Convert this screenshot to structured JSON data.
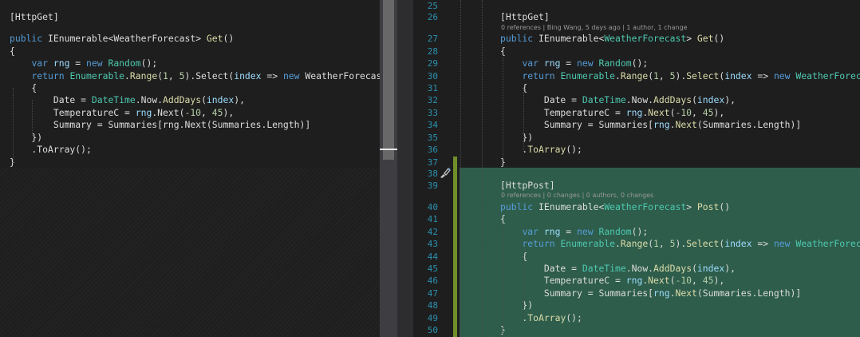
{
  "left": {
    "lines": [
      [
        {
          "t": "[HttpGet]",
          "c": "pl"
        }
      ],
      [],
      [
        {
          "t": "public ",
          "c": "kw"
        },
        {
          "t": "IEnumerable",
          "c": "pl"
        },
        {
          "t": "<",
          "c": "pl"
        },
        {
          "t": "WeatherForecast",
          "c": "pl"
        },
        {
          "t": "> ",
          "c": "pl"
        },
        {
          "t": "Get",
          "c": "fn"
        },
        {
          "t": "()",
          "c": "pl"
        }
      ],
      [
        {
          "t": "{",
          "c": "pl"
        }
      ],
      [
        {
          "t": "    ",
          "c": "pl"
        },
        {
          "t": "var ",
          "c": "kw"
        },
        {
          "t": "rng",
          "c": "va"
        },
        {
          "t": " = ",
          "c": "pl"
        },
        {
          "t": "new ",
          "c": "kw"
        },
        {
          "t": "Random",
          "c": "ty"
        },
        {
          "t": "();",
          "c": "pl"
        }
      ],
      [
        {
          "t": "    ",
          "c": "pl"
        },
        {
          "t": "return ",
          "c": "kw"
        },
        {
          "t": "Enumerable",
          "c": "ty"
        },
        {
          "t": ".",
          "c": "pl"
        },
        {
          "t": "Range",
          "c": "fn"
        },
        {
          "t": "(",
          "c": "pl"
        },
        {
          "t": "1",
          "c": "nu"
        },
        {
          "t": ", ",
          "c": "pl"
        },
        {
          "t": "5",
          "c": "nu"
        },
        {
          "t": ").Select(",
          "c": "pl"
        },
        {
          "t": "index",
          "c": "va"
        },
        {
          "t": " => ",
          "c": "pl"
        },
        {
          "t": "new ",
          "c": "kw"
        },
        {
          "t": "WeatherForecast",
          "c": "pl"
        }
      ],
      [
        {
          "t": "    {",
          "c": "pl"
        }
      ],
      [
        {
          "t": "        Date = ",
          "c": "pl"
        },
        {
          "t": "DateTime",
          "c": "ty"
        },
        {
          "t": ".Now.",
          "c": "pl"
        },
        {
          "t": "AddDays",
          "c": "fn"
        },
        {
          "t": "(",
          "c": "pl"
        },
        {
          "t": "index",
          "c": "va"
        },
        {
          "t": "),",
          "c": "pl"
        }
      ],
      [
        {
          "t": "        TemperatureC = ",
          "c": "pl"
        },
        {
          "t": "rng",
          "c": "va"
        },
        {
          "t": ".Next(",
          "c": "pl"
        },
        {
          "t": "-10",
          "c": "nu"
        },
        {
          "t": ", ",
          "c": "pl"
        },
        {
          "t": "45",
          "c": "nu"
        },
        {
          "t": "),",
          "c": "pl"
        }
      ],
      [
        {
          "t": "        Summary = Summaries[rng.Next(Summaries.Length)]",
          "c": "pl"
        }
      ],
      [
        {
          "t": "    })",
          "c": "pl"
        }
      ],
      [
        {
          "t": "    .ToArray();",
          "c": "pl"
        }
      ],
      [
        {
          "t": "}",
          "c": "pl"
        }
      ]
    ]
  },
  "right": {
    "rows": [
      {
        "n": "25",
        "code": []
      },
      {
        "n": "26",
        "code": [
          {
            "t": "[HttpGet]",
            "c": "pl"
          }
        ]
      },
      {
        "lens": "0 references | Bing Wang, 5 days ago | 1 author, 1 change"
      },
      {
        "n": "27",
        "code": [
          {
            "t": "public ",
            "c": "kw"
          },
          {
            "t": "IEnumerable",
            "c": "pl"
          },
          {
            "t": "<",
            "c": "pl"
          },
          {
            "t": "WeatherForecast",
            "c": "ty"
          },
          {
            "t": "> ",
            "c": "pl"
          },
          {
            "t": "Get",
            "c": "fn"
          },
          {
            "t": "()",
            "c": "pl"
          }
        ]
      },
      {
        "n": "28",
        "code": [
          {
            "t": "{",
            "c": "pl"
          }
        ]
      },
      {
        "n": "29",
        "code": [
          {
            "t": "    ",
            "c": "pl"
          },
          {
            "t": "var ",
            "c": "kw"
          },
          {
            "t": "rng",
            "c": "va"
          },
          {
            "t": " = ",
            "c": "pl"
          },
          {
            "t": "new ",
            "c": "kw"
          },
          {
            "t": "Random",
            "c": "ty"
          },
          {
            "t": "();",
            "c": "pl"
          }
        ]
      },
      {
        "n": "30",
        "code": [
          {
            "t": "    ",
            "c": "pl"
          },
          {
            "t": "return ",
            "c": "kw"
          },
          {
            "t": "Enumerable",
            "c": "ty"
          },
          {
            "t": ".",
            "c": "pl"
          },
          {
            "t": "Range",
            "c": "fn"
          },
          {
            "t": "(",
            "c": "pl"
          },
          {
            "t": "1",
            "c": "nu"
          },
          {
            "t": ", ",
            "c": "pl"
          },
          {
            "t": "5",
            "c": "nu"
          },
          {
            "t": ").",
            "c": "pl"
          },
          {
            "t": "Select",
            "c": "fn"
          },
          {
            "t": "(",
            "c": "pl"
          },
          {
            "t": "index",
            "c": "va"
          },
          {
            "t": " => ",
            "c": "pl"
          },
          {
            "t": "new ",
            "c": "kw"
          },
          {
            "t": "WeatherForecast",
            "c": "ty"
          }
        ]
      },
      {
        "n": "31",
        "code": [
          {
            "t": "    {",
            "c": "pl"
          }
        ]
      },
      {
        "n": "32",
        "code": [
          {
            "t": "        Date = ",
            "c": "pl"
          },
          {
            "t": "DateTime",
            "c": "ty"
          },
          {
            "t": ".Now.",
            "c": "pl"
          },
          {
            "t": "AddDays",
            "c": "fn"
          },
          {
            "t": "(",
            "c": "pl"
          },
          {
            "t": "index",
            "c": "va"
          },
          {
            "t": "),",
            "c": "pl"
          }
        ]
      },
      {
        "n": "33",
        "code": [
          {
            "t": "        TemperatureC = ",
            "c": "pl"
          },
          {
            "t": "rng",
            "c": "va"
          },
          {
            "t": ".",
            "c": "pl"
          },
          {
            "t": "Next",
            "c": "fn"
          },
          {
            "t": "(",
            "c": "pl"
          },
          {
            "t": "-10",
            "c": "nu"
          },
          {
            "t": ", ",
            "c": "pl"
          },
          {
            "t": "45",
            "c": "nu"
          },
          {
            "t": "),",
            "c": "pl"
          }
        ]
      },
      {
        "n": "34",
        "code": [
          {
            "t": "        Summary = Summaries[",
            "c": "pl"
          },
          {
            "t": "rng",
            "c": "va"
          },
          {
            "t": ".",
            "c": "pl"
          },
          {
            "t": "Next",
            "c": "fn"
          },
          {
            "t": "(Summaries.Length)]",
            "c": "pl"
          }
        ]
      },
      {
        "n": "35",
        "code": [
          {
            "t": "    })",
            "c": "pl"
          }
        ]
      },
      {
        "n": "36",
        "code": [
          {
            "t": "    .",
            "c": "pl"
          },
          {
            "t": "ToArray",
            "c": "fn"
          },
          {
            "t": "();",
            "c": "pl"
          }
        ]
      },
      {
        "n": "37",
        "code": [
          {
            "t": "}",
            "c": "pl"
          }
        ]
      },
      {
        "n": "38",
        "code": []
      },
      {
        "n": "39",
        "code": [
          {
            "t": "[HttpPost]",
            "c": "pl"
          }
        ]
      },
      {
        "lens": "0 references | 0 changes | 0 authors, 0 changes"
      },
      {
        "n": "40",
        "code": [
          {
            "t": "public ",
            "c": "kw"
          },
          {
            "t": "IEnumerable",
            "c": "pl"
          },
          {
            "t": "<",
            "c": "pl"
          },
          {
            "t": "WeatherForecast",
            "c": "ty"
          },
          {
            "t": "> ",
            "c": "pl"
          },
          {
            "t": "Post",
            "c": "fn"
          },
          {
            "t": "()",
            "c": "pl"
          }
        ]
      },
      {
        "n": "41",
        "code": [
          {
            "t": "{",
            "c": "pl"
          }
        ]
      },
      {
        "n": "42",
        "code": [
          {
            "t": "    ",
            "c": "pl"
          },
          {
            "t": "var ",
            "c": "kw"
          },
          {
            "t": "rng",
            "c": "va"
          },
          {
            "t": " = ",
            "c": "pl"
          },
          {
            "t": "new ",
            "c": "kw"
          },
          {
            "t": "Random",
            "c": "ty"
          },
          {
            "t": "();",
            "c": "pl"
          }
        ]
      },
      {
        "n": "43",
        "code": [
          {
            "t": "    ",
            "c": "pl"
          },
          {
            "t": "return ",
            "c": "kw"
          },
          {
            "t": "Enumerable",
            "c": "ty"
          },
          {
            "t": ".",
            "c": "pl"
          },
          {
            "t": "Range",
            "c": "fn"
          },
          {
            "t": "(",
            "c": "pl"
          },
          {
            "t": "1",
            "c": "nu"
          },
          {
            "t": ", ",
            "c": "pl"
          },
          {
            "t": "5",
            "c": "nu"
          },
          {
            "t": ").",
            "c": "pl"
          },
          {
            "t": "Select",
            "c": "fn"
          },
          {
            "t": "(",
            "c": "pl"
          },
          {
            "t": "index",
            "c": "va"
          },
          {
            "t": " => ",
            "c": "pl"
          },
          {
            "t": "new ",
            "c": "kw"
          },
          {
            "t": "WeatherForecast",
            "c": "ty"
          }
        ]
      },
      {
        "n": "44",
        "code": [
          {
            "t": "    {",
            "c": "pl"
          }
        ]
      },
      {
        "n": "45",
        "code": [
          {
            "t": "        Date = ",
            "c": "pl"
          },
          {
            "t": "DateTime",
            "c": "ty"
          },
          {
            "t": ".Now.",
            "c": "pl"
          },
          {
            "t": "AddDays",
            "c": "fn"
          },
          {
            "t": "(",
            "c": "pl"
          },
          {
            "t": "index",
            "c": "va"
          },
          {
            "t": "),",
            "c": "pl"
          }
        ]
      },
      {
        "n": "46",
        "code": [
          {
            "t": "        TemperatureC = ",
            "c": "pl"
          },
          {
            "t": "rng",
            "c": "va"
          },
          {
            "t": ".",
            "c": "pl"
          },
          {
            "t": "Next",
            "c": "fn"
          },
          {
            "t": "(",
            "c": "pl"
          },
          {
            "t": "-10",
            "c": "nu"
          },
          {
            "t": ", ",
            "c": "pl"
          },
          {
            "t": "45",
            "c": "nu"
          },
          {
            "t": "),",
            "c": "pl"
          }
        ]
      },
      {
        "n": "47",
        "code": [
          {
            "t": "        Summary = Summaries[",
            "c": "pl"
          },
          {
            "t": "rng",
            "c": "va"
          },
          {
            "t": ".",
            "c": "pl"
          },
          {
            "t": "Next",
            "c": "fn"
          },
          {
            "t": "(Summaries.Length)]",
            "c": "pl"
          }
        ]
      },
      {
        "n": "48",
        "code": [
          {
            "t": "    })",
            "c": "pl"
          }
        ]
      },
      {
        "n": "49",
        "code": [
          {
            "t": "    .",
            "c": "pl"
          },
          {
            "t": "ToArray",
            "c": "fn"
          },
          {
            "t": "();",
            "c": "pl"
          }
        ]
      },
      {
        "n": "50",
        "code": [
          {
            "t": "}",
            "c": "pl"
          }
        ]
      }
    ]
  },
  "colors": {
    "added_background": "#2e5d4b",
    "added_indicator": "#6f8f2b",
    "line_number": "#2b91af",
    "keyword": "#569cd6",
    "type": "#4ec9b0",
    "method": "#dcdcaa",
    "number": "#b5cea8",
    "variable": "#9cdcfe"
  },
  "icons": {
    "gutter_glyph": "quick-actions-brush-icon"
  }
}
